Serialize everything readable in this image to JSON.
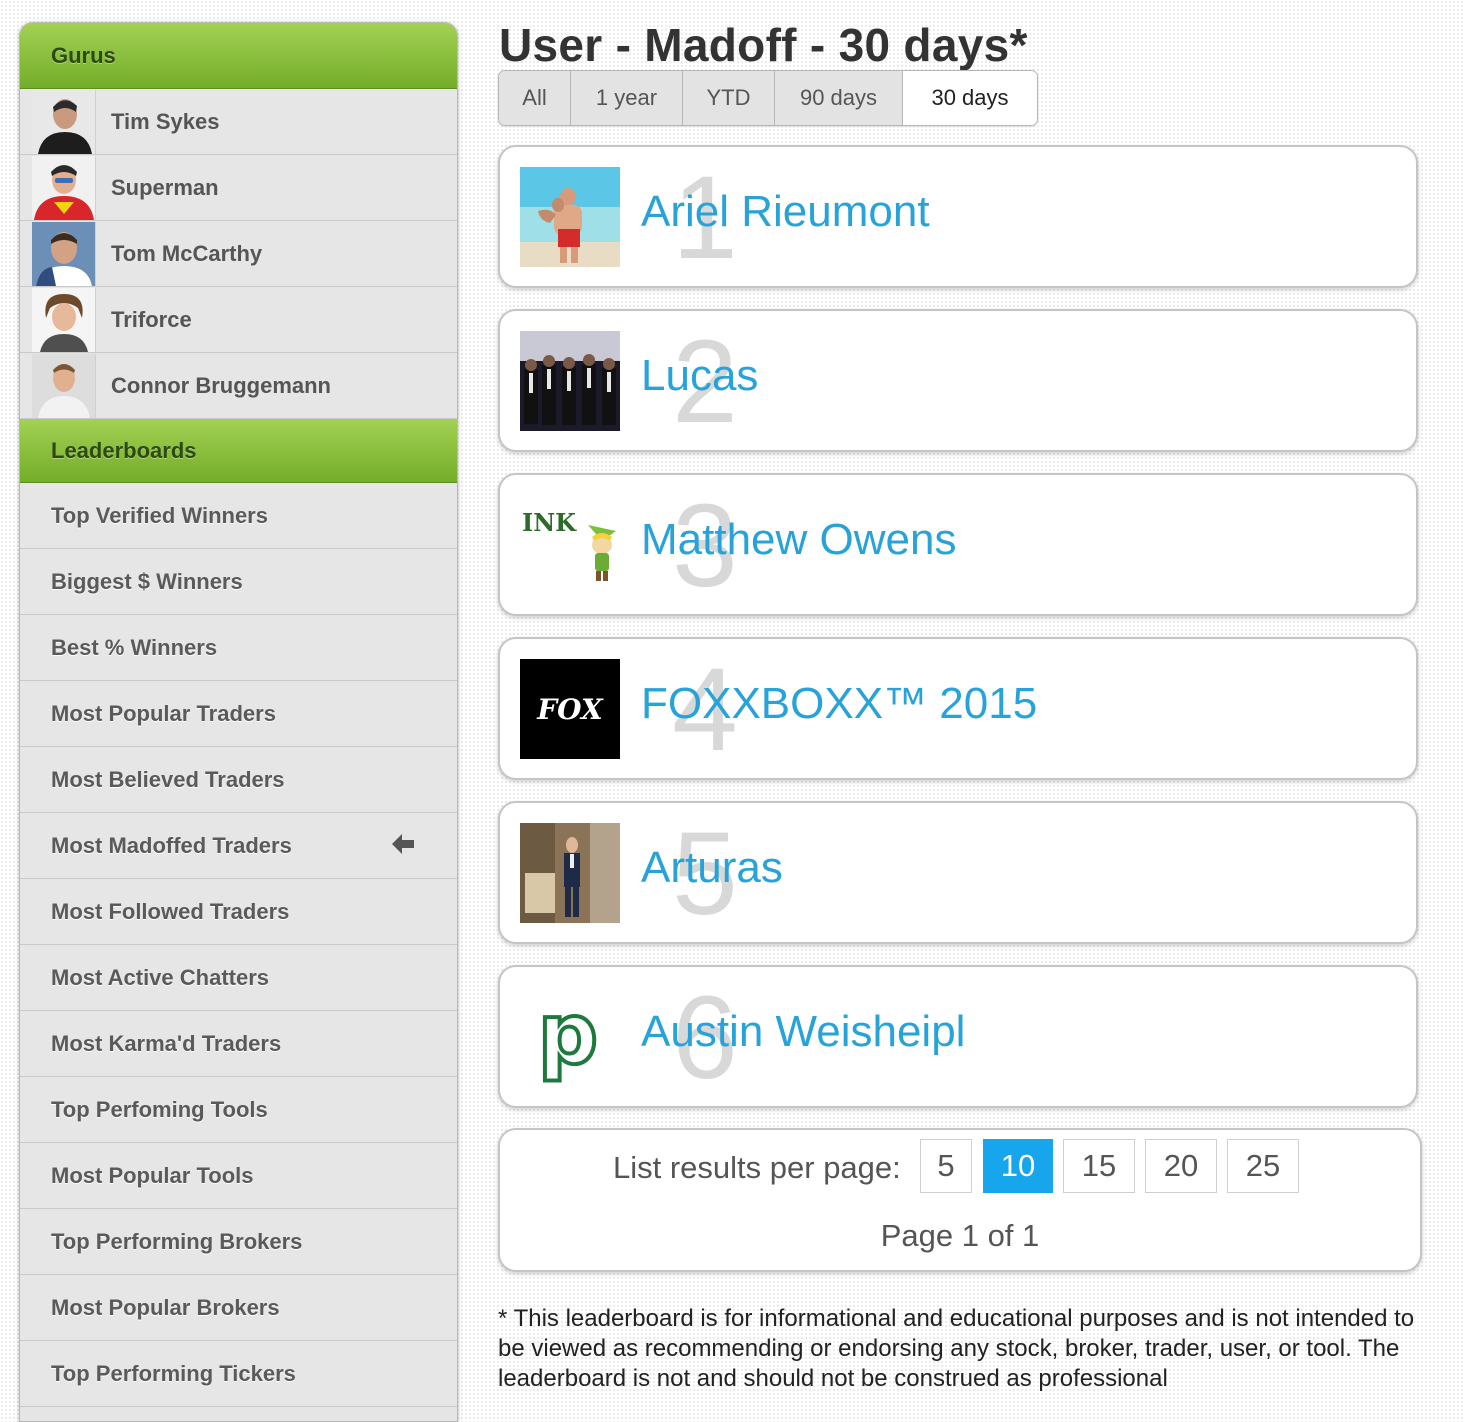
{
  "sidebar": {
    "gurus_header": "Gurus",
    "gurus": [
      {
        "name": "Tim Sykes"
      },
      {
        "name": "Superman"
      },
      {
        "name": "Tom McCarthy"
      },
      {
        "name": "Triforce"
      },
      {
        "name": "Connor Bruggemann"
      }
    ],
    "leaderboards_header": "Leaderboards",
    "leaderboards": [
      {
        "label": "Top Verified Winners"
      },
      {
        "label": "Biggest $ Winners"
      },
      {
        "label": "Best % Winners"
      },
      {
        "label": "Most Popular Traders"
      },
      {
        "label": "Most Believed Traders"
      },
      {
        "label": "Most Madoffed Traders",
        "current": true,
        "indicator_icon": "arrow-left-icon"
      },
      {
        "label": "Most Followed Traders"
      },
      {
        "label": "Most Active Chatters"
      },
      {
        "label": "Most Karma'd Traders"
      },
      {
        "label": "Top Perfoming Tools"
      },
      {
        "label": "Most Popular Tools"
      },
      {
        "label": "Top Performing Brokers"
      },
      {
        "label": "Most Popular Brokers"
      },
      {
        "label": "Top Performing Tickers"
      }
    ]
  },
  "main": {
    "title": "User - Madoff - 30 days*",
    "tabs": [
      {
        "label": "All"
      },
      {
        "label": "1 year"
      },
      {
        "label": "YTD"
      },
      {
        "label": "90 days"
      },
      {
        "label": "30 days",
        "active": true
      }
    ],
    "entries": [
      {
        "rank": "1",
        "name": "Ariel Rieumont"
      },
      {
        "rank": "2",
        "name": "Lucas"
      },
      {
        "rank": "3",
        "name": "Matthew Owens",
        "avatar_text": "INK"
      },
      {
        "rank": "4",
        "name": "FOXXBOXX™ 2015",
        "avatar_text": "FOX"
      },
      {
        "rank": "5",
        "name": "Arturas"
      },
      {
        "rank": "6",
        "name": "Austin Weisheipl",
        "avatar_text": "p"
      }
    ],
    "pagination": {
      "label": "List results per page:",
      "options": [
        "5",
        "10",
        "15",
        "20",
        "25"
      ],
      "selected": "10",
      "page_info": "Page 1 of 1"
    },
    "disclaimer": "* This leaderboard is for informational and educational purposes and is not intended to be viewed as recommending or endorsing any stock, broker, trader, user, or tool. The leaderboard is not and should not be construed as professional"
  },
  "colors": {
    "accent_green": "#74ad2a",
    "link_blue": "#28a3d9",
    "active_page_blue": "#17a6ec"
  }
}
